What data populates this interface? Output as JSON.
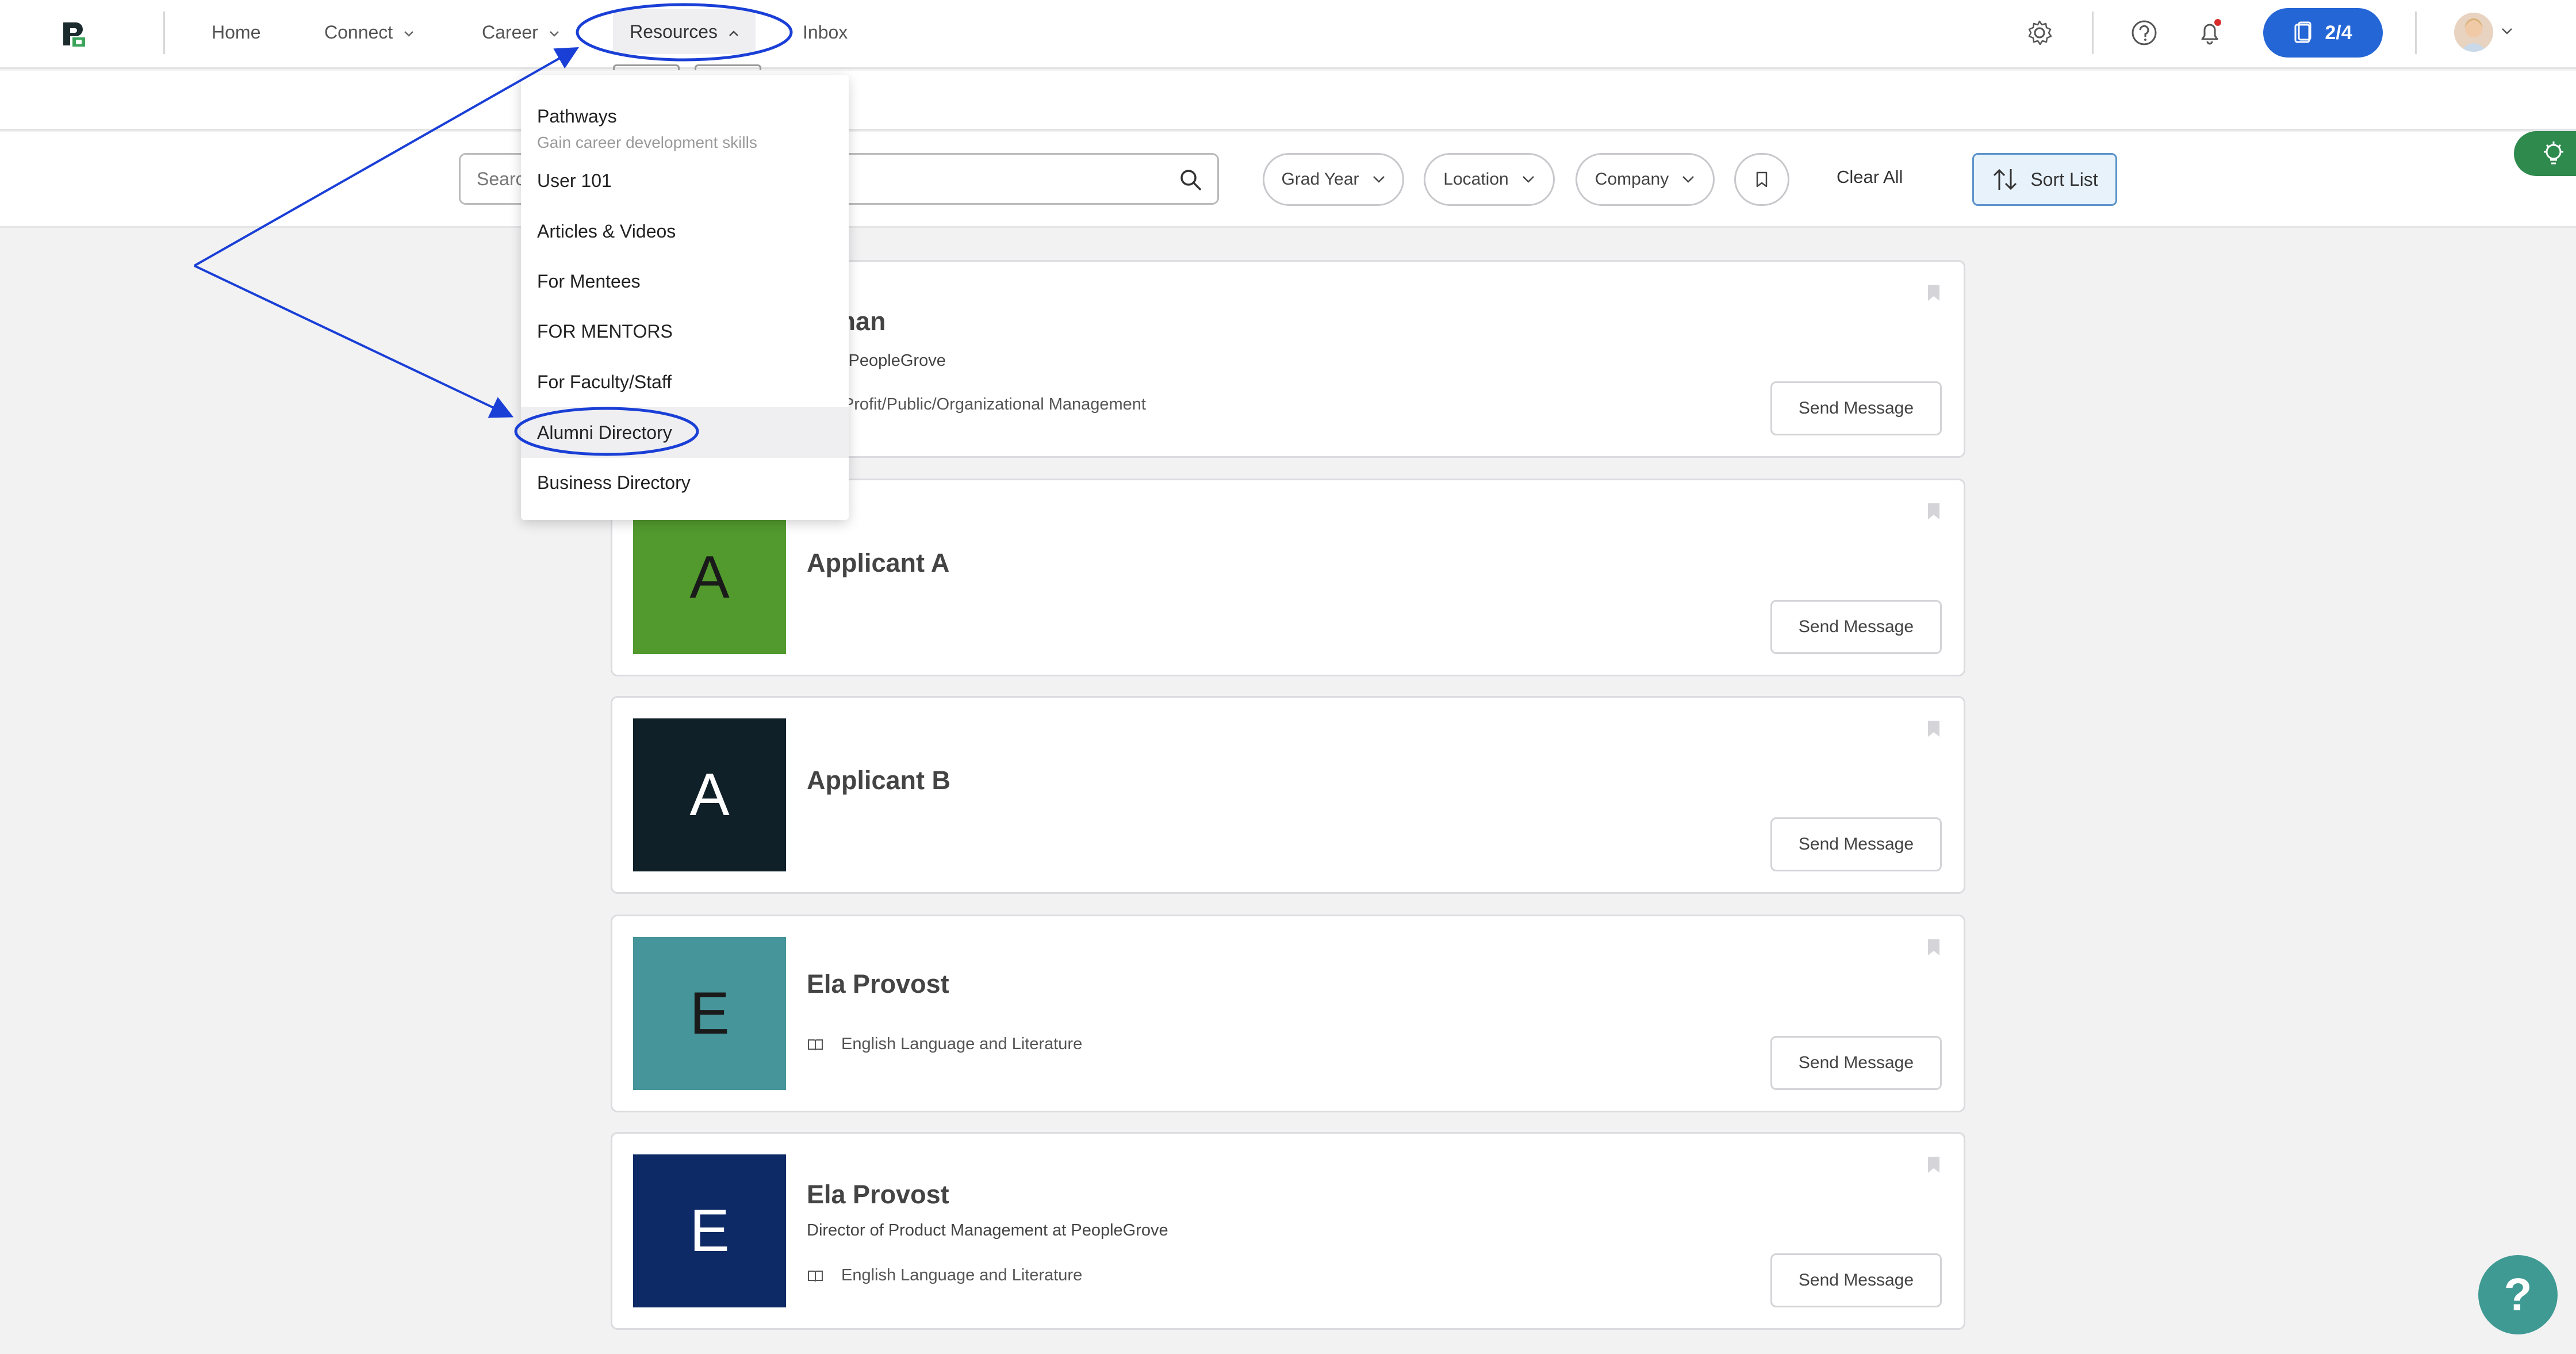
{
  "nav": {
    "items": [
      {
        "label": "Home"
      },
      {
        "label": "Connect"
      },
      {
        "label": "Career"
      },
      {
        "label": "Resources"
      },
      {
        "label": "Inbox"
      }
    ],
    "progress": "2/4"
  },
  "search": {
    "placeholder": "Search"
  },
  "filters": {
    "chips": [
      {
        "label": "Grad Year"
      },
      {
        "label": "Location"
      },
      {
        "label": "Company"
      }
    ],
    "clear_all": "Clear All",
    "sort": "Sort List"
  },
  "dropdown": {
    "items": [
      {
        "label": "Pathways",
        "desc": "Gain career development skills"
      },
      {
        "label": "User 101"
      },
      {
        "label": "Articles & Videos"
      },
      {
        "label": "For Mentees"
      },
      {
        "label": "FOR MENTORS"
      },
      {
        "label": "For Faculty/Staff"
      },
      {
        "label": "Alumni Directory"
      },
      {
        "label": "Business Directory"
      }
    ]
  },
  "cards": [
    {
      "initial": "",
      "name": "l Khan",
      "sub": "ed at PeopleGrove",
      "detail": "Non-Profit/Public/Organizational Management",
      "color": "#ffffff",
      "button": "Send Message"
    },
    {
      "initial": "A",
      "name": "Applicant A",
      "sub": "",
      "detail": "",
      "color": "#529a2e",
      "button": "Send Message"
    },
    {
      "initial": "A",
      "name": "Applicant B",
      "sub": "",
      "detail": "",
      "color": "#0f2029",
      "button": "Send Message"
    },
    {
      "initial": "E",
      "name": "Ela Provost",
      "sub": "",
      "detail": "English Language and Literature",
      "color": "#45959a",
      "button": "Send Message"
    },
    {
      "initial": "E",
      "name": "Ela Provost",
      "sub": "Director of Product Management at PeopleGrove",
      "detail": "English Language and Literature",
      "color": "#0e2a66",
      "button": "Send Message"
    }
  ],
  "colors": {
    "accent": "#2566d6",
    "annotation": "#1a3fd6",
    "brand_green": "#2f8a4e"
  },
  "help": "?"
}
